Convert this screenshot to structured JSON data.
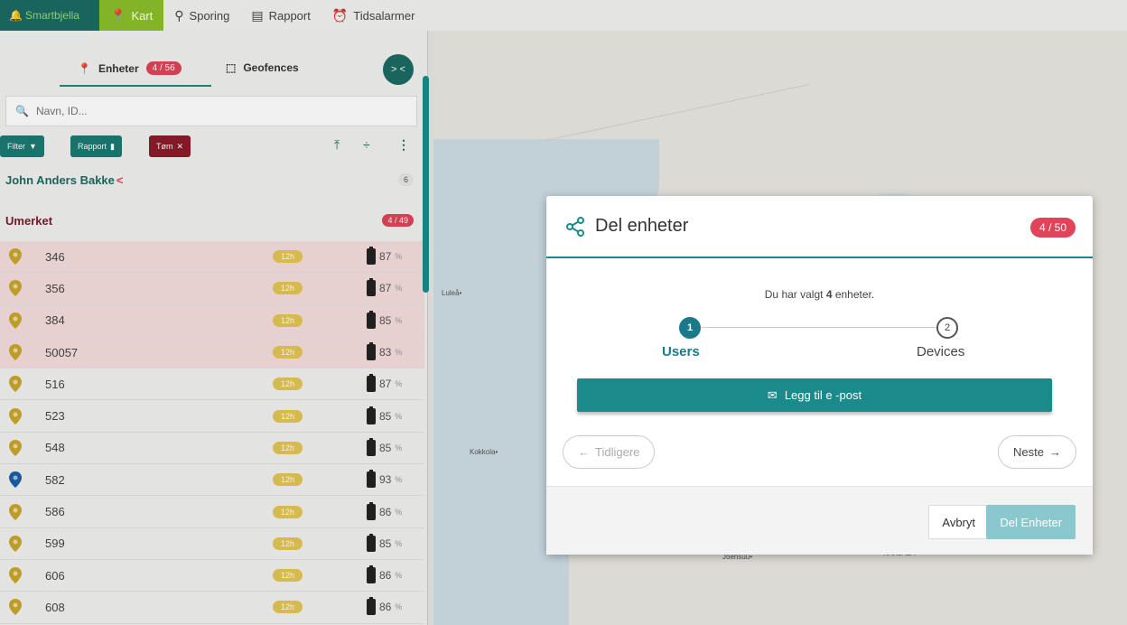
{
  "nav": {
    "brand": "Smartbjella",
    "items": [
      {
        "label": "Kart",
        "icon": "map-pin-icon"
      },
      {
        "label": "Sporing",
        "icon": "tracking-icon"
      },
      {
        "label": "Rapport",
        "icon": "report-icon"
      },
      {
        "label": "Tidsalarmer",
        "icon": "alarm-clock-icon"
      }
    ]
  },
  "sidebar": {
    "tabs": {
      "units_label": "Enheter",
      "units_count": "4 / 56",
      "geofences_label": "Geofences"
    },
    "collapse_label": "> <",
    "search": {
      "placeholder": "Navn, ID..."
    },
    "toolbar": {
      "filter_label": "Filter",
      "report_label": "Rapport",
      "clear_label": "Tøm"
    },
    "groups": [
      {
        "name": "John Anders Bakke",
        "count": "6"
      },
      {
        "name": "Umerket",
        "count": "4 / 49"
      }
    ],
    "rows": [
      {
        "id": "346",
        "age": "12h",
        "battery": "87",
        "selected": true,
        "pin": "yellow"
      },
      {
        "id": "356",
        "age": "12h",
        "battery": "87",
        "selected": true,
        "pin": "yellow"
      },
      {
        "id": "384",
        "age": "12h",
        "battery": "85",
        "selected": true,
        "pin": "yellow"
      },
      {
        "id": "50057",
        "age": "12h",
        "battery": "83",
        "selected": true,
        "pin": "yellow"
      },
      {
        "id": "516",
        "age": "12h",
        "battery": "87",
        "selected": false,
        "pin": "yellow"
      },
      {
        "id": "523",
        "age": "12h",
        "battery": "85",
        "selected": false,
        "pin": "yellow"
      },
      {
        "id": "548",
        "age": "12h",
        "battery": "85",
        "selected": false,
        "pin": "yellow"
      },
      {
        "id": "582",
        "age": "12h",
        "battery": "93",
        "selected": false,
        "pin": "blue"
      },
      {
        "id": "586",
        "age": "12h",
        "battery": "86",
        "selected": false,
        "pin": "yellow"
      },
      {
        "id": "599",
        "age": "12h",
        "battery": "85",
        "selected": false,
        "pin": "yellow"
      },
      {
        "id": "606",
        "age": "12h",
        "battery": "86",
        "selected": false,
        "pin": "yellow"
      },
      {
        "id": "608",
        "age": "12h",
        "battery": "86",
        "selected": false,
        "pin": "yellow"
      }
    ],
    "percent_sign": "%"
  },
  "map": {
    "labels": [
      "Luleå•",
      "Kokkola•",
      "Joensuu•",
      "KARJALA"
    ]
  },
  "modal": {
    "title": "Del enheter",
    "count": "4 / 50",
    "info_prefix": "Du har valgt ",
    "info_count": "4",
    "info_suffix": " enheter.",
    "steps": [
      {
        "number": "1",
        "label": "Users"
      },
      {
        "number": "2",
        "label": "Devices"
      }
    ],
    "add_email_label": "Legg til e -post",
    "prev_label": "Tidligere",
    "next_label": "Neste",
    "cancel_label": "Avbryt",
    "share_label": "Del Enheter"
  },
  "colors": {
    "teal": "#1b8a8a",
    "accent_red": "#e0445a",
    "nav_active": "#8cbf2a",
    "selected_row": "#f5dede"
  }
}
